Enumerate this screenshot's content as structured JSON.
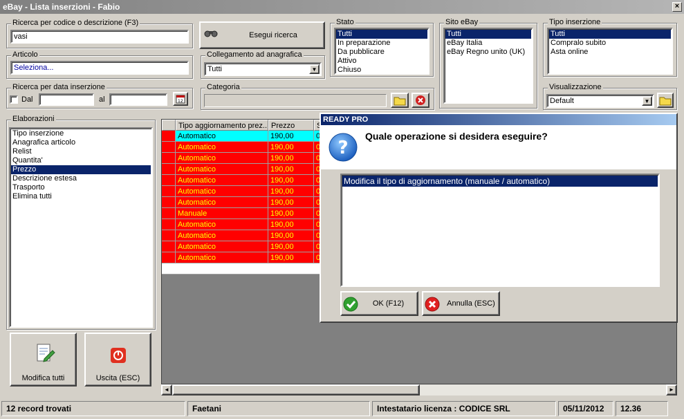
{
  "window": {
    "title": "eBay - Lista inserzioni - Fabio",
    "close_glyph": "×"
  },
  "search": {
    "label": "Ricerca per codice o descrizione (F3)",
    "value": "vasi",
    "button_label": "Esegui ricerca"
  },
  "articolo": {
    "label": "Articolo",
    "value": "Seleziona..."
  },
  "collegamento": {
    "label": "Collegamento ad anagrafica",
    "value": "Tutti"
  },
  "date_search": {
    "label": "Ricerca per data inserzione",
    "from_label": "Dal",
    "to_label": "al",
    "from_value": "",
    "to_value": ""
  },
  "categoria": {
    "label": "Categoria",
    "value": ""
  },
  "stato": {
    "label": "Stato",
    "items": [
      "Tutti",
      "In preparazione",
      "Da pubblicare",
      "Attivo",
      "Chiuso"
    ],
    "selected": 0
  },
  "sito": {
    "label": "Sito eBay",
    "items": [
      "Tutti",
      "eBay Italia",
      "eBay Regno unito (UK)"
    ],
    "selected": 0
  },
  "tipo": {
    "label": "Tipo inserzione",
    "items": [
      "Tutti",
      "Compralo subito",
      "Asta online"
    ],
    "selected": 0
  },
  "visualizzazione": {
    "label": "Visualizzazione",
    "value": "Default"
  },
  "elaborazioni": {
    "label": "Elaborazioni",
    "items": [
      "Tipo inserzione",
      "Anagrafica articolo",
      "Relist",
      "Quantita'",
      "Prezzo",
      "Descrizione estesa",
      "Trasporto",
      "Elimina tutti"
    ],
    "selected": 4
  },
  "buttons": {
    "modifica": "Modifica tutti",
    "uscita": "Uscita (ESC)"
  },
  "grid": {
    "columns": [
      "Tipo aggiornamento prez...",
      "Prezzo",
      "S"
    ],
    "rows": [
      {
        "tipo": "Automatico",
        "prezzo": "190,00",
        "s": "0",
        "highlight": true
      },
      {
        "tipo": "Automatico",
        "prezzo": "190,00",
        "s": "0",
        "highlight": false
      },
      {
        "tipo": "Automatico",
        "prezzo": "190,00",
        "s": "0",
        "highlight": false
      },
      {
        "tipo": "Automatico",
        "prezzo": "190,00",
        "s": "0",
        "highlight": false
      },
      {
        "tipo": "Automatico",
        "prezzo": "190,00",
        "s": "0",
        "highlight": false
      },
      {
        "tipo": "Automatico",
        "prezzo": "190,00",
        "s": "0",
        "highlight": false
      },
      {
        "tipo": "Automatico",
        "prezzo": "190,00",
        "s": "0",
        "highlight": false
      },
      {
        "tipo": "Manuale",
        "prezzo": "190,00",
        "s": "0",
        "highlight": false
      },
      {
        "tipo": "Automatico",
        "prezzo": "190,00",
        "s": "0",
        "highlight": false
      },
      {
        "tipo": "Automatico",
        "prezzo": "190,00",
        "s": "0",
        "highlight": false
      },
      {
        "tipo": "Automatico",
        "prezzo": "190,00",
        "s": "0",
        "highlight": false
      },
      {
        "tipo": "Automatico",
        "prezzo": "190,00",
        "s": "0",
        "highlight": false
      }
    ],
    "scroll_left": "◄",
    "scroll_right": "►"
  },
  "dialog": {
    "title": "READY PRO",
    "question": "Quale operazione si desidera eseguire?",
    "options": [
      "Modifica il tipo di aggiornamento (manuale / automatico)"
    ],
    "selected": 0,
    "ok_label": "OK (F12)",
    "cancel_label": "Annulla (ESC)"
  },
  "status": {
    "records": "12 record trovati",
    "user": "Faetani",
    "license": "Intestatario licenza : CODICE SRL",
    "date": "05/11/2012",
    "time": "12.36"
  },
  "colors": {
    "row_red": "#ff0000",
    "row_text": "#ffff00",
    "row_highlight": "#00ffff",
    "selection": "#0a246a"
  }
}
